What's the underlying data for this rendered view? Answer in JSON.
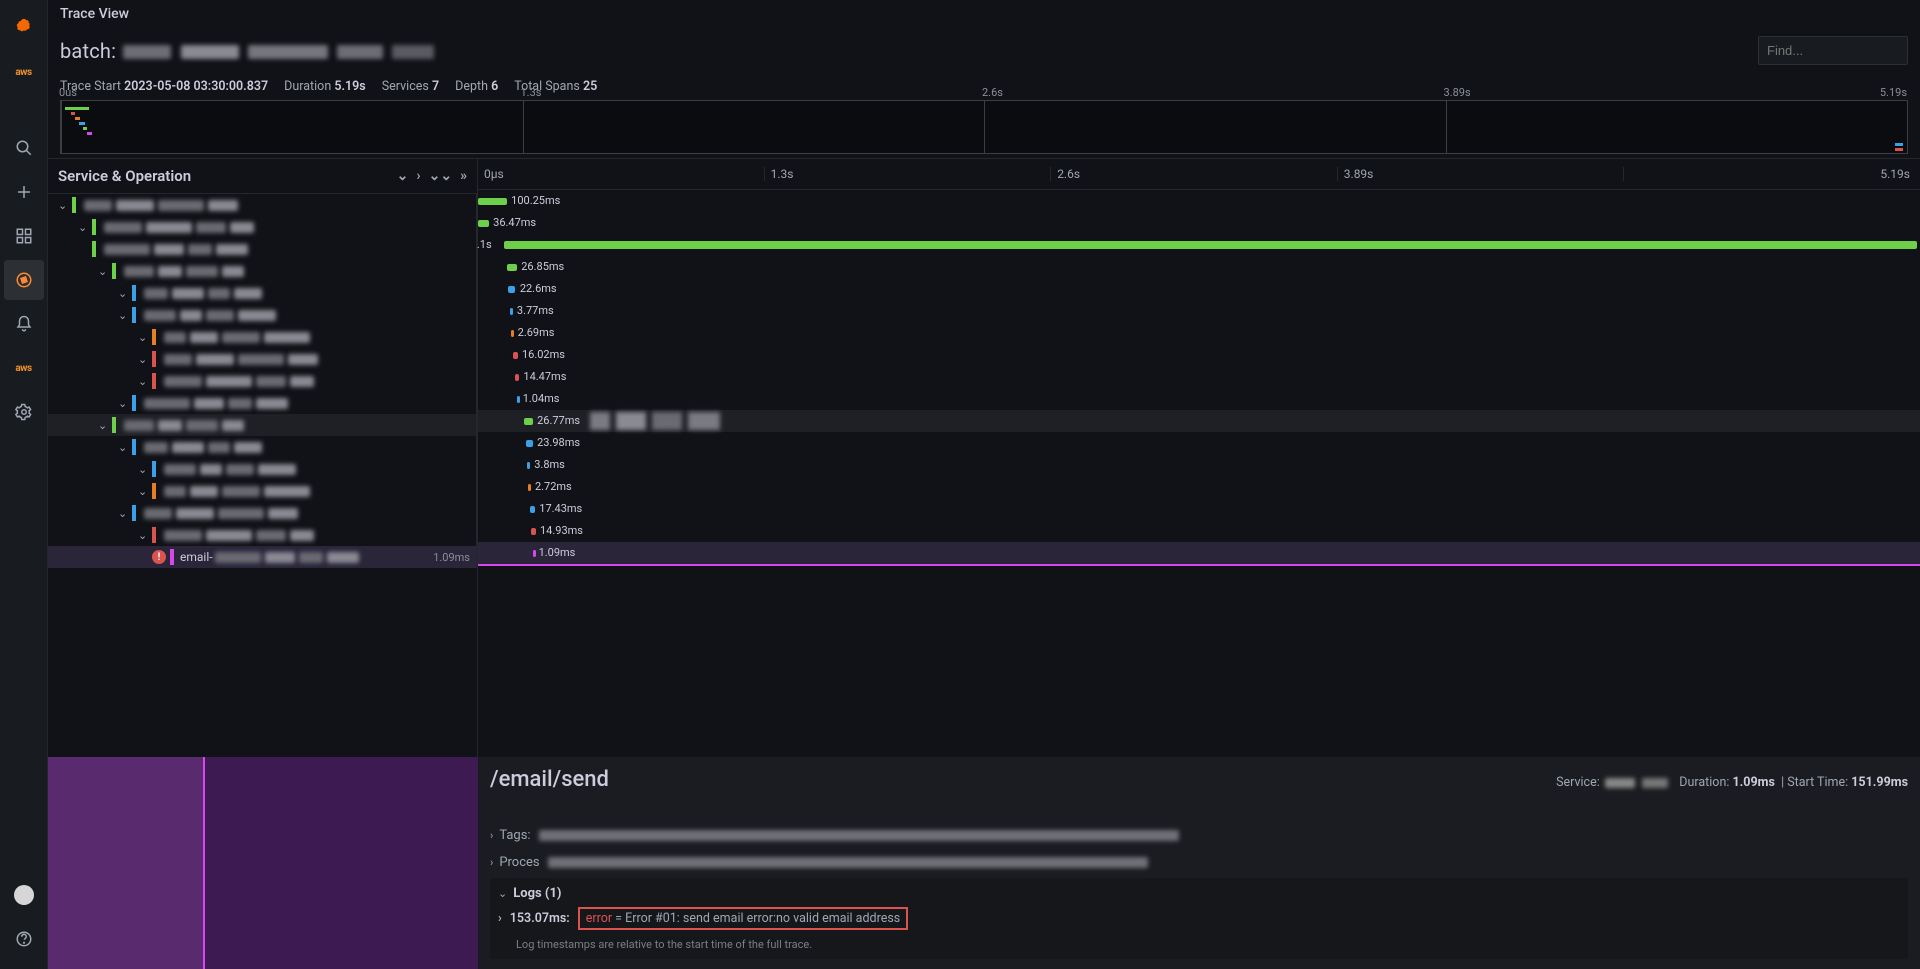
{
  "header": {
    "title": "Trace View"
  },
  "trace_title_prefix": "batch: ",
  "find_placeholder": "Find...",
  "meta": {
    "start_label": "Trace Start",
    "start_value": "2023-05-08 03:30:00.837",
    "duration_label": "Duration",
    "duration_value": "5.19s",
    "services_label": "Services",
    "services_value": "7",
    "depth_label": "Depth",
    "depth_value": "6",
    "spans_label": "Total Spans",
    "spans_value": "25"
  },
  "minimap_ticks": [
    "0us",
    "1.3s",
    "2.6s",
    "3.89s",
    "5.19s"
  ],
  "so_header": "Service & Operation",
  "timeline_ticks": [
    "0μs",
    "1.3s",
    "2.6s",
    "3.89s",
    "5.19s"
  ],
  "spans": [
    {
      "indent": 0,
      "chev": true,
      "color": "#6ecf4a",
      "dur": "100.25ms",
      "offset": 0,
      "width": 2.0
    },
    {
      "indent": 1,
      "chev": true,
      "color": "#6ecf4a",
      "dur": "36.47ms",
      "offset": 0,
      "width": 0.75
    },
    {
      "indent": 1,
      "chev": false,
      "color": "#6ecf4a",
      "dur": ".1s",
      "offset": 0,
      "width": 100,
      "tall": true,
      "preLabel": true
    },
    {
      "indent": 2,
      "chev": true,
      "color": "#6ecf4a",
      "dur": "26.85ms",
      "offset": 2.0,
      "width": 0.7
    },
    {
      "indent": 3,
      "chev": true,
      "color": "#3aa0e8",
      "dur": "22.6ms",
      "offset": 2.1,
      "width": 0.5
    },
    {
      "indent": 3,
      "chev": true,
      "color": "#3aa0e8",
      "dur": "3.77ms",
      "offset": 2.2,
      "width": 0.2
    },
    {
      "indent": 4,
      "chev": true,
      "color": "#e67e22",
      "dur": "2.69ms",
      "offset": 2.3,
      "width": 0.15
    },
    {
      "indent": 4,
      "chev": true,
      "color": "#d9534f",
      "dur": "16.02ms",
      "offset": 2.4,
      "width": 0.35
    },
    {
      "indent": 4,
      "chev": true,
      "color": "#d9534f",
      "dur": "14.47ms",
      "offset": 2.55,
      "width": 0.3
    },
    {
      "indent": 3,
      "chev": true,
      "color": "#3aa0e8",
      "dur": "1.04ms",
      "offset": 2.7,
      "width": 0.1
    },
    {
      "indent": 2,
      "chev": true,
      "color": "#6ecf4a",
      "dur": "26.77ms",
      "offset": 3.2,
      "width": 0.6,
      "hl": true,
      "extra": true
    },
    {
      "indent": 3,
      "chev": true,
      "color": "#3aa0e8",
      "dur": "23.98ms",
      "offset": 3.3,
      "width": 0.5
    },
    {
      "indent": 4,
      "chev": true,
      "color": "#3aa0e8",
      "dur": "3.8ms",
      "offset": 3.4,
      "width": 0.2
    },
    {
      "indent": 4,
      "chev": true,
      "color": "#e67e22",
      "dur": "2.72ms",
      "offset": 3.5,
      "width": 0.15
    },
    {
      "indent": 3,
      "chev": true,
      "color": "#3aa0e8",
      "dur": "17.43ms",
      "offset": 3.6,
      "width": 0.35
    },
    {
      "indent": 4,
      "chev": true,
      "color": "#d9534f",
      "dur": "14.93ms",
      "offset": 3.7,
      "width": 0.3
    },
    {
      "indent": 4,
      "chev": false,
      "color": "#d946ef",
      "dur": "1.09ms",
      "offset": 3.8,
      "width": 0.1,
      "sel": true,
      "err": true,
      "label": "email-",
      "rightDur": "1.09ms"
    }
  ],
  "detail": {
    "title": "/email/send",
    "service_label": "Service:",
    "duration_label": "Duration:",
    "duration_value": "1.09ms",
    "start_label": "Start Time:",
    "start_value": "151.99ms",
    "tags_label": "Tags:",
    "process_label": "Proces",
    "logs_label": "Logs (1)",
    "log_ts": "153.07ms:",
    "log_error_word": "error",
    "log_eq": " = ",
    "log_msg": "Error #01: send email error:no valid email address",
    "log_hint": "Log timestamps are relative to the start time of the full trace."
  }
}
